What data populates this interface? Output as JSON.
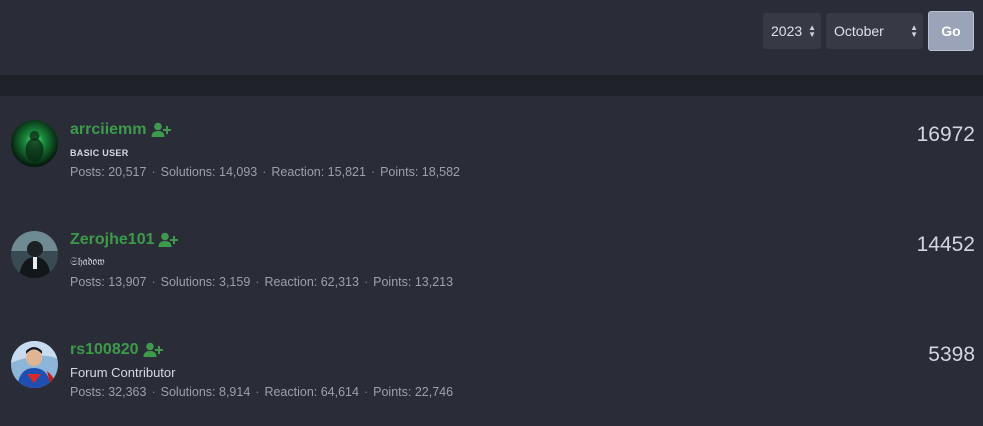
{
  "filters": {
    "year": "2023",
    "month": "October",
    "go_label": "Go"
  },
  "users": [
    {
      "username": "arrciiemm",
      "title": "BASIC USER",
      "stats": [
        "Posts: 20,517",
        "Solutions: 14,093",
        "Reaction: 15,821",
        "Points: 18,582"
      ],
      "score": "16972",
      "avatar": "green-glow-avatar"
    },
    {
      "username": "Zerojhe101",
      "title": "𝔖𝔥𝔞𝔡𝔬𝔴",
      "stats": [
        "Posts: 13,907",
        "Solutions: 3,159",
        "Reaction: 62,313",
        "Points: 13,213"
      ],
      "score": "14452",
      "avatar": "dark-figure-avatar"
    },
    {
      "username": "rs100820",
      "title": "Forum Contributor",
      "stats": [
        "Posts: 32,363",
        "Solutions: 8,914",
        "Reaction: 64,614",
        "Points: 22,746"
      ],
      "score": "5398",
      "avatar": "superhero-avatar"
    }
  ],
  "colors": {
    "background": "#2a2d37",
    "username": "#3d9a4a",
    "go_button": "#9aa3b8"
  }
}
